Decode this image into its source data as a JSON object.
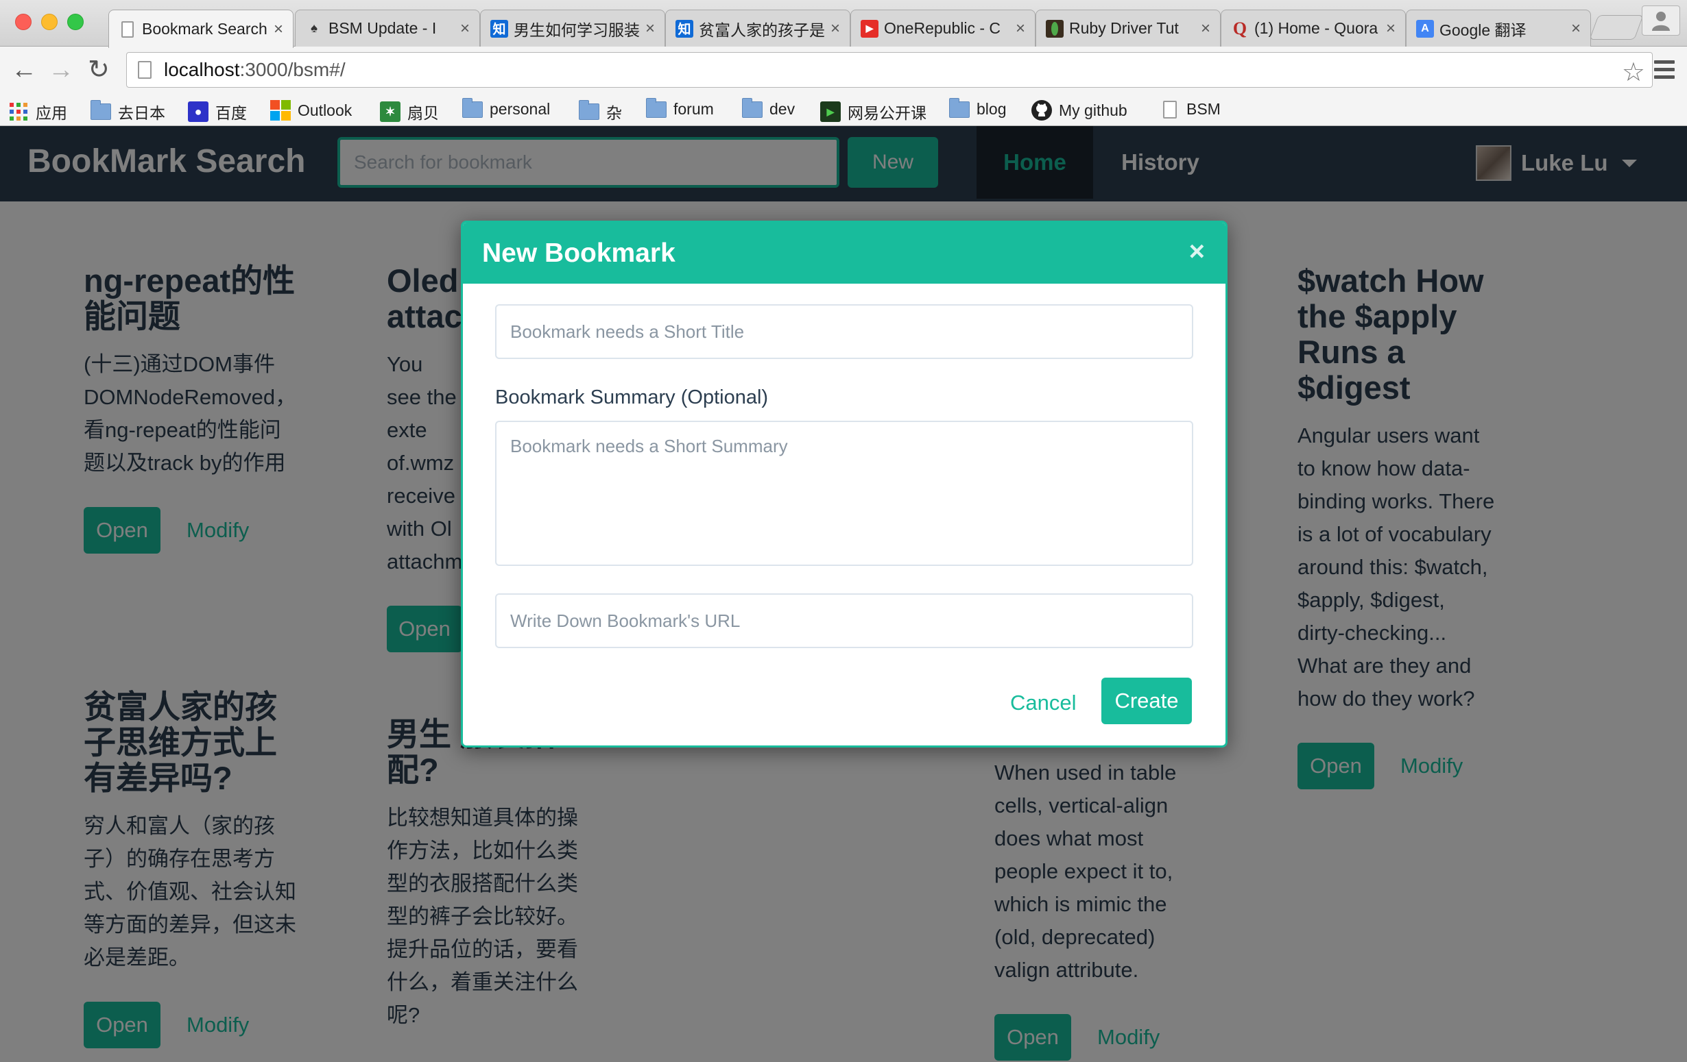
{
  "browser": {
    "tabs": [
      {
        "title": "Bookmark Search",
        "icon": "page-icon",
        "close": "×"
      },
      {
        "title": "BSM Update - I",
        "icon": "bsm-icon",
        "close": "×"
      },
      {
        "title": "男生如何学习服装",
        "icon": "zhihu-icon",
        "icon_text": "知",
        "close": "×"
      },
      {
        "title": "贫富人家的孩子是",
        "icon": "zhihu-icon",
        "icon_text": "知",
        "close": "×"
      },
      {
        "title": "OneRepublic - C",
        "icon": "youtube-icon",
        "close": "×"
      },
      {
        "title": "Ruby Driver Tut",
        "icon": "mongodb-icon",
        "close": "×"
      },
      {
        "title": "(1) Home - Quora",
        "icon": "quora-icon",
        "icon_text": "Q",
        "close": "×"
      },
      {
        "title": "Google 翻译",
        "icon": "translate-icon",
        "icon_text": "A",
        "close": "×"
      }
    ],
    "url_host": "localhost",
    "url_rest": ":3000/bsm#/",
    "bookmarks": [
      {
        "label": "应用",
        "icon": "apps-grid-icon"
      },
      {
        "label": "去日本",
        "icon": "folder-icon"
      },
      {
        "label": "百度",
        "icon": "baidu-icon"
      },
      {
        "label": "Outlook",
        "icon": "windows-icon"
      },
      {
        "label": "扇贝",
        "icon": "shanbay-icon"
      },
      {
        "label": "personal",
        "icon": "folder-icon"
      },
      {
        "label": "杂",
        "icon": "folder-icon"
      },
      {
        "label": "forum",
        "icon": "folder-icon"
      },
      {
        "label": "dev",
        "icon": "folder-icon"
      },
      {
        "label": "网易公开课",
        "icon": "netease-icon"
      },
      {
        "label": "blog",
        "icon": "folder-icon"
      },
      {
        "label": "My github",
        "icon": "github-icon"
      },
      {
        "label": "BSM",
        "icon": "page-icon"
      }
    ]
  },
  "app": {
    "brand": "BookMark Search",
    "search_placeholder": "Search for bookmark",
    "new_label": "New",
    "nav": {
      "home": "Home",
      "history": "History"
    },
    "user_name": "Luke Lu",
    "colors": {
      "primary": "#18bc9c",
      "navbar": "#2c3e50",
      "active_nav": "#1a242f"
    }
  },
  "cards": [
    {
      "title": "ng-repeat的性能问题",
      "summary": "(十三)通过DOM事件DOMNodeRemoved，看ng-repeat的性能问题以及track by的作用",
      "open": "Open",
      "modify": "Modify"
    },
    {
      "title": "Oled attac",
      "summary": "You see the exte of.wmz receive with Ol attachm",
      "open": "Open",
      "modify": ""
    },
    {
      "title": "$watch How the $apply Runs a $digest",
      "summary": "Angular users want to know how data-binding works. There is a lot of vocabulary around this: $watch, $apply, $digest, dirty-checking... What are they and how do they work?",
      "open": "Open",
      "modify": "Modify"
    },
    {
      "title": "贫富人家的孩子思维方式上有差异吗?",
      "summary": "穷人和富人（家的孩子）的确存在思考方式、价值观、社会认知等方面的差异，但这未必是差距。",
      "open": "Open",
      "modify": "Modify"
    },
    {
      "title": "男生 服装搭配?",
      "summary": "比较想知道具体的操作方法，比如什么类型的衣服搭配什么类型的裤子会比较好。提升品位的话，要看什么，着重关注什么呢?",
      "open": "",
      "modify": ""
    },
    {
      "title": "",
      "summary": "When used in table cells, vertical-align does what most people expect it to, which is mimic the (old, deprecated) valign attribute.",
      "open": "Open",
      "modify": "Modify"
    }
  ],
  "modal": {
    "title": "New Bookmark",
    "close": "×",
    "title_placeholder": "Bookmark needs a Short Title",
    "summary_label": "Bookmark Summary (Optional)",
    "summary_placeholder": "Bookmark needs a Short Summary",
    "url_placeholder": "Write Down Bookmark's URL",
    "cancel_label": "Cancel",
    "create_label": "Create"
  }
}
